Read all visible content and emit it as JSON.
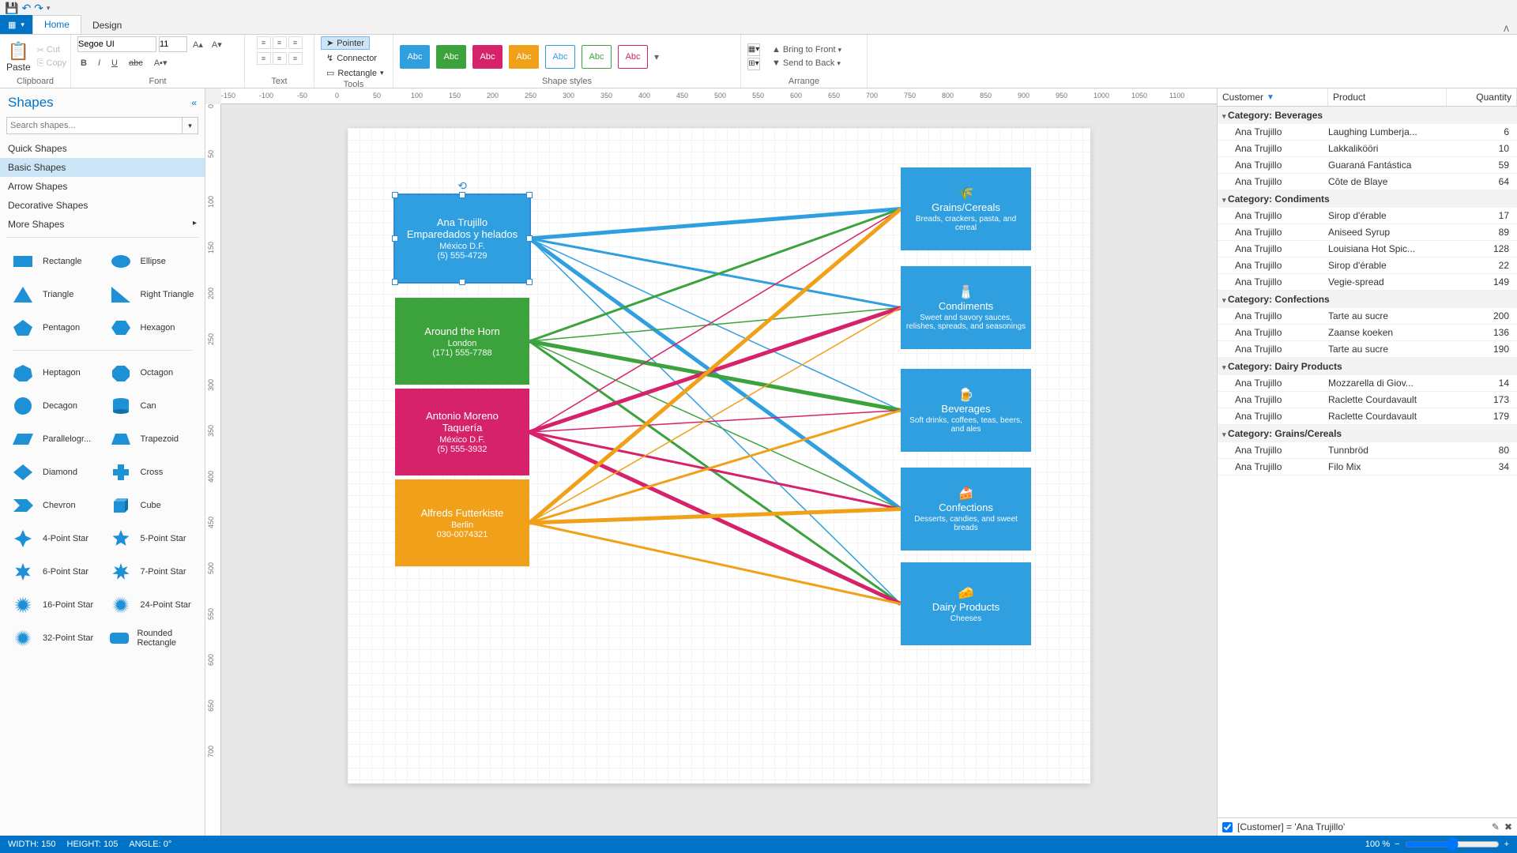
{
  "qat_tips": [
    "save",
    "undo",
    "redo",
    "dropdown"
  ],
  "tabs": {
    "file": "",
    "home": "Home",
    "design": "Design"
  },
  "ribbon": {
    "clipboard": {
      "paste": "Paste",
      "cut": "Cut",
      "copy": "Copy",
      "label": "Clipboard"
    },
    "font": {
      "family": "Segoe UI",
      "size": "11",
      "label": "Font"
    },
    "text": {
      "label": "Text"
    },
    "tools": {
      "pointer": "Pointer",
      "connector": "Connector",
      "rectangle": "Rectangle",
      "label": "Tools"
    },
    "styles": {
      "sample": "Abc",
      "label": "Shape styles"
    },
    "arrange": {
      "front": "Bring to Front",
      "back": "Send to Back",
      "label": "Arrange"
    }
  },
  "shapes_panel": {
    "title": "Shapes",
    "search_ph": "Search shapes...",
    "cats": [
      "Quick Shapes",
      "Basic Shapes",
      "Arrow Shapes",
      "Decorative Shapes",
      "More Shapes"
    ],
    "items": [
      "Rectangle",
      "Ellipse",
      "Triangle",
      "Right Triangle",
      "Pentagon",
      "Hexagon",
      "Heptagon",
      "Octagon",
      "Decagon",
      "Can",
      "Parallelogr...",
      "Trapezoid",
      "Diamond",
      "Cross",
      "Chevron",
      "Cube",
      "4-Point Star",
      "5-Point Star",
      "6-Point Star",
      "7-Point Star",
      "16-Point Star",
      "24-Point Star",
      "32-Point Star",
      "Rounded Rectangle"
    ]
  },
  "customers": [
    {
      "name": "Ana Trujillo",
      "sub": "Emparedados y helados",
      "city": "México D.F.",
      "phone": "(5) 555-4729",
      "color": "#2f9fe0",
      "selected": true
    },
    {
      "name": "Around the Horn",
      "sub": "",
      "city": "London",
      "phone": "(171) 555-7788",
      "color": "#3ca23c"
    },
    {
      "name": "Antonio Moreno",
      "sub": "Taquería",
      "city": "México D.F.",
      "phone": "(5) 555-3932",
      "color": "#d6226a"
    },
    {
      "name": "Alfreds Futterkiste",
      "sub": "",
      "city": "Berlin",
      "phone": "030-0074321",
      "color": "#f0a019"
    }
  ],
  "categories": [
    {
      "name": "Grains/Cereals",
      "desc": "Breads, crackers, pasta, and cereal",
      "icon": "🌾"
    },
    {
      "name": "Condiments",
      "desc": "Sweet and savory sauces, relishes, spreads, and seasonings",
      "icon": "🧂"
    },
    {
      "name": "Beverages",
      "desc": "Soft drinks, coffees, teas, beers, and ales",
      "icon": "🍺"
    },
    {
      "name": "Confections",
      "desc": "Desserts, candies, and sweet breads",
      "icon": "🍰"
    },
    {
      "name": "Dairy Products",
      "desc": "Cheeses",
      "icon": "🧀"
    }
  ],
  "grid": {
    "headers": {
      "c1": "Customer",
      "c2": "Product",
      "c3": "Quantity"
    },
    "groups": [
      {
        "title": "Category: Beverages",
        "rows": [
          {
            "cust": "Ana Trujillo",
            "prod": "Laughing Lumberja...",
            "qty": 6
          },
          {
            "cust": "Ana Trujillo",
            "prod": "Lakkalikööri",
            "qty": 10
          },
          {
            "cust": "Ana Trujillo",
            "prod": "Guaraná Fantástica",
            "qty": 59
          },
          {
            "cust": "Ana Trujillo",
            "prod": "Côte de Blaye",
            "qty": 64
          }
        ]
      },
      {
        "title": "Category: Condiments",
        "rows": [
          {
            "cust": "Ana Trujillo",
            "prod": "Sirop d'érable",
            "qty": 17
          },
          {
            "cust": "Ana Trujillo",
            "prod": "Aniseed Syrup",
            "qty": 89
          },
          {
            "cust": "Ana Trujillo",
            "prod": "Louisiana Hot Spic...",
            "qty": 128
          },
          {
            "cust": "Ana Trujillo",
            "prod": "Sirop d'érable",
            "qty": 22
          },
          {
            "cust": "Ana Trujillo",
            "prod": "Vegie-spread",
            "qty": 149
          }
        ]
      },
      {
        "title": "Category: Confections",
        "rows": [
          {
            "cust": "Ana Trujillo",
            "prod": "Tarte au sucre",
            "qty": 200
          },
          {
            "cust": "Ana Trujillo",
            "prod": "Zaanse koeken",
            "qty": 136
          },
          {
            "cust": "Ana Trujillo",
            "prod": "Tarte au sucre",
            "qty": 190
          }
        ]
      },
      {
        "title": "Category: Dairy Products",
        "rows": [
          {
            "cust": "Ana Trujillo",
            "prod": "Mozzarella di Giov...",
            "qty": 14
          },
          {
            "cust": "Ana Trujillo",
            "prod": "Raclette Courdavault",
            "qty": 173
          },
          {
            "cust": "Ana Trujillo",
            "prod": "Raclette Courdavault",
            "qty": 179
          }
        ]
      },
      {
        "title": "Category: Grains/Cereals",
        "rows": [
          {
            "cust": "Ana Trujillo",
            "prod": "Tunnbröd",
            "qty": 80
          },
          {
            "cust": "Ana Trujillo",
            "prod": "Filo Mix",
            "qty": 34
          }
        ]
      }
    ],
    "filter": "[Customer] = 'Ana Trujillo'"
  },
  "status": {
    "width": "WIDTH: 150",
    "height": "HEIGHT: 105",
    "angle": "ANGLE: 0°",
    "zoom": "100 %"
  },
  "ruler_h": [
    "-150",
    "-100",
    "-50",
    "0",
    "50",
    "100",
    "150",
    "200",
    "250",
    "300",
    "350",
    "400",
    "450",
    "500",
    "550",
    "600",
    "650",
    "700",
    "750",
    "800",
    "850",
    "900",
    "950",
    "1000",
    "1050",
    "1100"
  ],
  "ruler_v": [
    "0",
    "50",
    "100",
    "150",
    "200",
    "250",
    "300",
    "350",
    "400",
    "450",
    "500",
    "550",
    "600",
    "650",
    "700"
  ]
}
